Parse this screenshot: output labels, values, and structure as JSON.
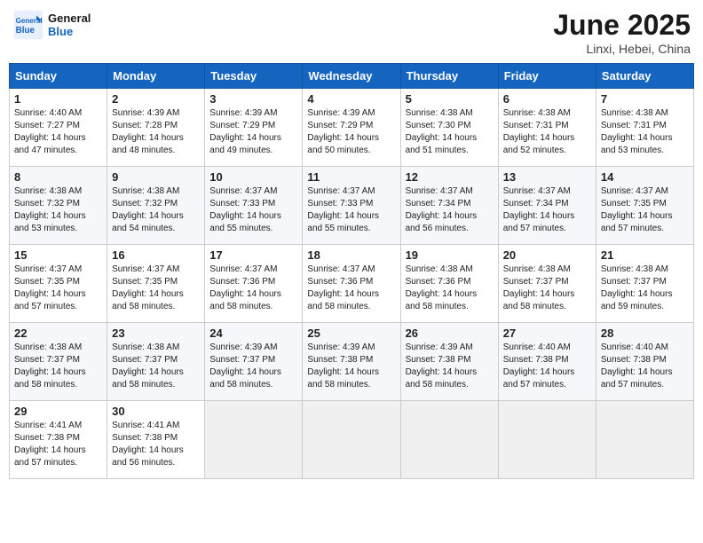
{
  "header": {
    "logo_general": "General",
    "logo_blue": "Blue",
    "month_year": "June 2025",
    "location": "Linxi, Hebei, China"
  },
  "weekdays": [
    "Sunday",
    "Monday",
    "Tuesday",
    "Wednesday",
    "Thursday",
    "Friday",
    "Saturday"
  ],
  "weeks": [
    [
      {
        "day": "1",
        "sunrise": "4:40 AM",
        "sunset": "7:27 PM",
        "daylight": "14 hours and 47 minutes."
      },
      {
        "day": "2",
        "sunrise": "4:39 AM",
        "sunset": "7:28 PM",
        "daylight": "14 hours and 48 minutes."
      },
      {
        "day": "3",
        "sunrise": "4:39 AM",
        "sunset": "7:29 PM",
        "daylight": "14 hours and 49 minutes."
      },
      {
        "day": "4",
        "sunrise": "4:39 AM",
        "sunset": "7:29 PM",
        "daylight": "14 hours and 50 minutes."
      },
      {
        "day": "5",
        "sunrise": "4:38 AM",
        "sunset": "7:30 PM",
        "daylight": "14 hours and 51 minutes."
      },
      {
        "day": "6",
        "sunrise": "4:38 AM",
        "sunset": "7:31 PM",
        "daylight": "14 hours and 52 minutes."
      },
      {
        "day": "7",
        "sunrise": "4:38 AM",
        "sunset": "7:31 PM",
        "daylight": "14 hours and 53 minutes."
      }
    ],
    [
      {
        "day": "8",
        "sunrise": "4:38 AM",
        "sunset": "7:32 PM",
        "daylight": "14 hours and 53 minutes."
      },
      {
        "day": "9",
        "sunrise": "4:38 AM",
        "sunset": "7:32 PM",
        "daylight": "14 hours and 54 minutes."
      },
      {
        "day": "10",
        "sunrise": "4:37 AM",
        "sunset": "7:33 PM",
        "daylight": "14 hours and 55 minutes."
      },
      {
        "day": "11",
        "sunrise": "4:37 AM",
        "sunset": "7:33 PM",
        "daylight": "14 hours and 55 minutes."
      },
      {
        "day": "12",
        "sunrise": "4:37 AM",
        "sunset": "7:34 PM",
        "daylight": "14 hours and 56 minutes."
      },
      {
        "day": "13",
        "sunrise": "4:37 AM",
        "sunset": "7:34 PM",
        "daylight": "14 hours and 57 minutes."
      },
      {
        "day": "14",
        "sunrise": "4:37 AM",
        "sunset": "7:35 PM",
        "daylight": "14 hours and 57 minutes."
      }
    ],
    [
      {
        "day": "15",
        "sunrise": "4:37 AM",
        "sunset": "7:35 PM",
        "daylight": "14 hours and 57 minutes."
      },
      {
        "day": "16",
        "sunrise": "4:37 AM",
        "sunset": "7:35 PM",
        "daylight": "14 hours and 58 minutes."
      },
      {
        "day": "17",
        "sunrise": "4:37 AM",
        "sunset": "7:36 PM",
        "daylight": "14 hours and 58 minutes."
      },
      {
        "day": "18",
        "sunrise": "4:37 AM",
        "sunset": "7:36 PM",
        "daylight": "14 hours and 58 minutes."
      },
      {
        "day": "19",
        "sunrise": "4:38 AM",
        "sunset": "7:36 PM",
        "daylight": "14 hours and 58 minutes."
      },
      {
        "day": "20",
        "sunrise": "4:38 AM",
        "sunset": "7:37 PM",
        "daylight": "14 hours and 58 minutes."
      },
      {
        "day": "21",
        "sunrise": "4:38 AM",
        "sunset": "7:37 PM",
        "daylight": "14 hours and 59 minutes."
      }
    ],
    [
      {
        "day": "22",
        "sunrise": "4:38 AM",
        "sunset": "7:37 PM",
        "daylight": "14 hours and 58 minutes."
      },
      {
        "day": "23",
        "sunrise": "4:38 AM",
        "sunset": "7:37 PM",
        "daylight": "14 hours and 58 minutes."
      },
      {
        "day": "24",
        "sunrise": "4:39 AM",
        "sunset": "7:37 PM",
        "daylight": "14 hours and 58 minutes."
      },
      {
        "day": "25",
        "sunrise": "4:39 AM",
        "sunset": "7:38 PM",
        "daylight": "14 hours and 58 minutes."
      },
      {
        "day": "26",
        "sunrise": "4:39 AM",
        "sunset": "7:38 PM",
        "daylight": "14 hours and 58 minutes."
      },
      {
        "day": "27",
        "sunrise": "4:40 AM",
        "sunset": "7:38 PM",
        "daylight": "14 hours and 57 minutes."
      },
      {
        "day": "28",
        "sunrise": "4:40 AM",
        "sunset": "7:38 PM",
        "daylight": "14 hours and 57 minutes."
      }
    ],
    [
      {
        "day": "29",
        "sunrise": "4:41 AM",
        "sunset": "7:38 PM",
        "daylight": "14 hours and 57 minutes."
      },
      {
        "day": "30",
        "sunrise": "4:41 AM",
        "sunset": "7:38 PM",
        "daylight": "14 hours and 56 minutes."
      },
      null,
      null,
      null,
      null,
      null
    ]
  ]
}
